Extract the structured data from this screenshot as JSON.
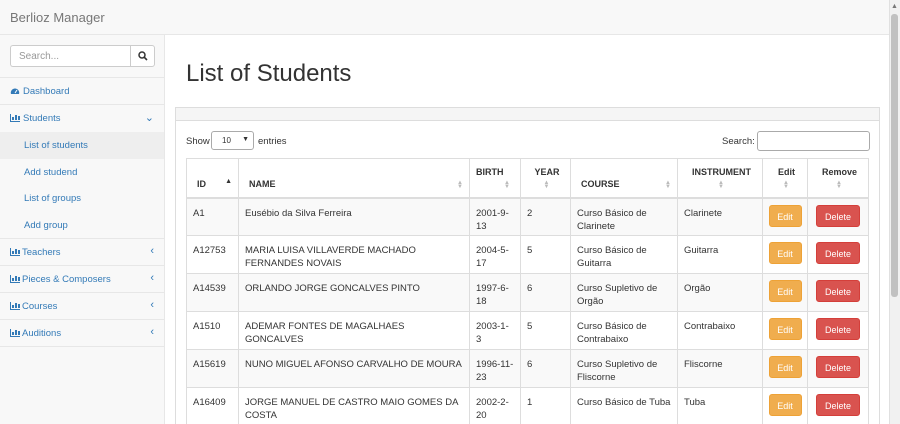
{
  "app": {
    "title": "Berlioz Manager"
  },
  "search": {
    "placeholder": "Search..."
  },
  "sidebar": {
    "dashboard": "Dashboard",
    "students": "Students",
    "students_sub": [
      "List of students",
      "Add studend",
      "List of groups",
      "Add group"
    ],
    "teachers": "Teachers",
    "pieces": "Pieces & Composers",
    "courses": "Courses",
    "auditions": "Auditions"
  },
  "page": {
    "title": "List of Students"
  },
  "table_controls": {
    "show_label": "Show",
    "length_value": "10",
    "entries_label": "entries",
    "search_label": "Search:"
  },
  "table": {
    "headers": {
      "id": "ID",
      "name": "NAME",
      "birth": "BIRTH",
      "year": "YEAR",
      "course": "COURSE",
      "instrument": "INSTRUMENT",
      "edit": "Edit",
      "remove": "Remove"
    },
    "edit_label": "Edit",
    "delete_label": "Delete",
    "rows": [
      {
        "id": "A1",
        "name": "Eusébio da Silva Ferreira",
        "birth": "2001-9-13",
        "year": "2",
        "course": "Curso Básico de Clarinete",
        "instrument": "Clarinete"
      },
      {
        "id": "A12753",
        "name": "MARIA LUISA VILLAVERDE MACHADO FERNANDES NOVAIS",
        "birth": "2004-5-17",
        "year": "5",
        "course": "Curso Básico de Guitarra",
        "instrument": "Guitarra"
      },
      {
        "id": "A14539",
        "name": "ORLANDO JORGE GONCALVES PINTO",
        "birth": "1997-6-18",
        "year": "6",
        "course": "Curso Supletivo de Orgão",
        "instrument": "Orgão"
      },
      {
        "id": "A1510",
        "name": "ADEMAR FONTES DE MAGALHAES GONCALVES",
        "birth": "2003-1-3",
        "year": "5",
        "course": "Curso Básico de Contrabaixo",
        "instrument": "Contrabaixo"
      },
      {
        "id": "A15619",
        "name": "NUNO MIGUEL AFONSO CARVALHO DE MOURA",
        "birth": "1996-11-23",
        "year": "6",
        "course": "Curso Supletivo de Fliscorne",
        "instrument": "Fliscorne"
      },
      {
        "id": "A16409",
        "name": "JORGE MANUEL DE CASTRO MAIO GOMES DA COSTA",
        "birth": "2002-2-20",
        "year": "1",
        "course": "Curso Básico de Tuba",
        "instrument": "Tuba"
      }
    ]
  },
  "colors": {
    "link": "#337ab7",
    "edit": "#f0ad4e",
    "delete": "#d9534f"
  }
}
